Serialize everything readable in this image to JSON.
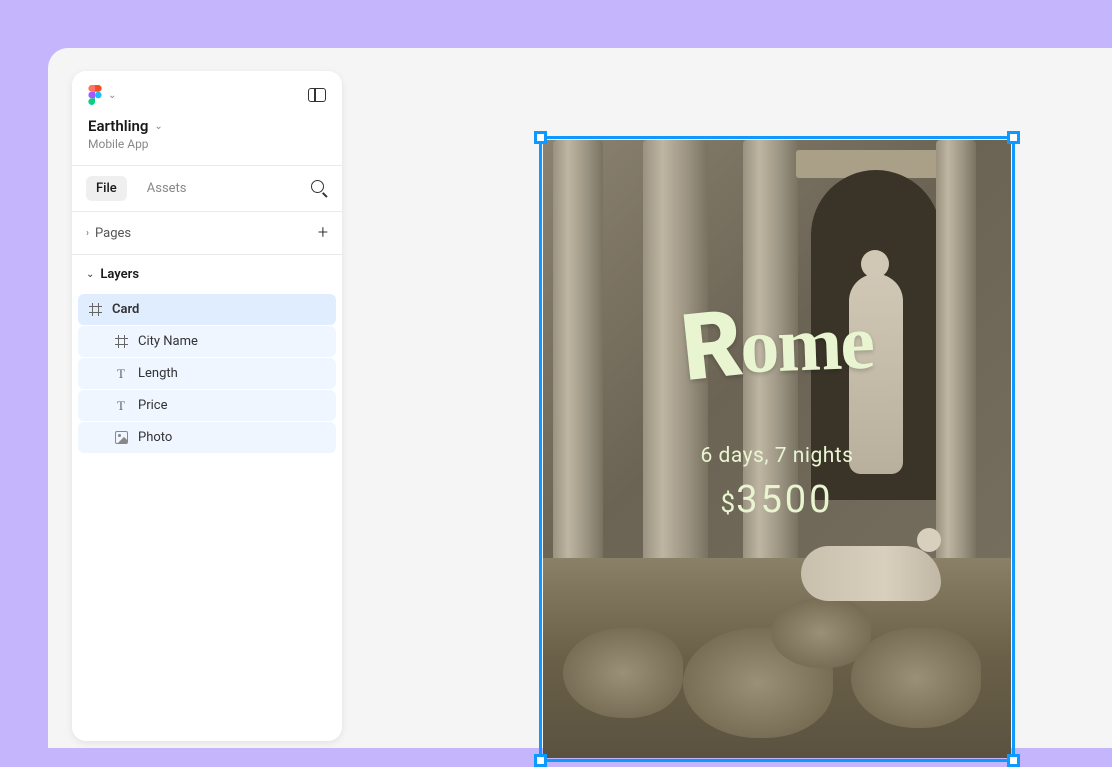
{
  "sidebar": {
    "project_title": "Earthling",
    "project_subtitle": "Mobile App",
    "tabs": {
      "file": "File",
      "assets": "Assets"
    },
    "pages_label": "Pages",
    "layers_label": "Layers",
    "layers": [
      {
        "name": "Card",
        "type": "frame",
        "selected": true
      },
      {
        "name": "City Name",
        "type": "frame",
        "selected": false
      },
      {
        "name": "Length",
        "type": "text",
        "selected": false
      },
      {
        "name": "Price",
        "type": "text",
        "selected": false
      },
      {
        "name": "Photo",
        "type": "image",
        "selected": false
      }
    ]
  },
  "card": {
    "city_name": "Rome",
    "length": "6 days, 7 nights",
    "currency": "$",
    "price": "3500"
  }
}
